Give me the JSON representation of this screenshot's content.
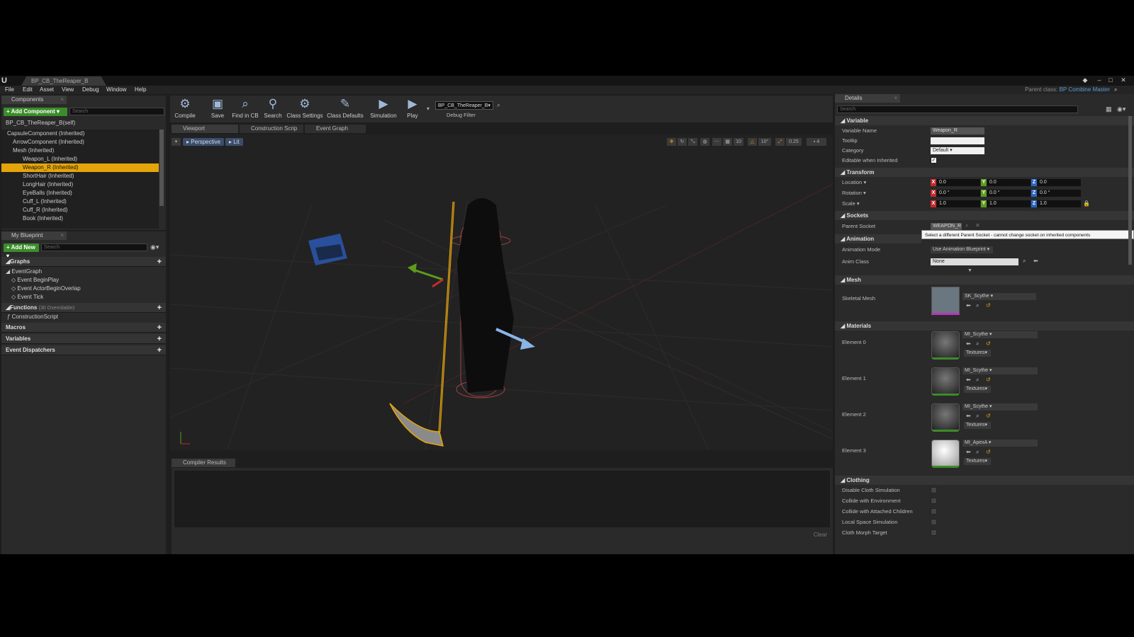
{
  "window": {
    "doc_tab": "BP_CB_TheReaper_B",
    "parent_class_label": "Parent class:",
    "parent_class": "BP Combine Master"
  },
  "menu": [
    "File",
    "Edit",
    "Asset",
    "View",
    "Debug",
    "Window",
    "Help"
  ],
  "components": {
    "tab": "Components",
    "add_button": "Add Component",
    "search_placeholder": "Search",
    "self": "BP_CB_TheReaper_B(self)",
    "tree": [
      "CapsuleComponent (Inherited)",
      "ArrowComponent (Inherited)",
      "Mesh (Inherited)",
      "Weapon_L (Inherited)",
      "Weapon_R (Inherited)",
      "ShortHair (Inherited)",
      "LongHair (Inherited)",
      "EyeBalls (Inherited)",
      "Cuff_L (Inherited)",
      "Cuff_R (Inherited)",
      "Book (Inherited)"
    ]
  },
  "my_blueprint": {
    "tab": "My Blueprint",
    "add_button": "Add New",
    "search_placeholder": "Search",
    "graphs": "Graphs",
    "event_graph": "EventGraph",
    "events": [
      "Event BeginPlay",
      "Event ActorBeginOverlap",
      "Event Tick"
    ],
    "functions": "Functions",
    "functions_note": "(30 Overridable)",
    "construction": "ConstructionScript",
    "macros": "Macros",
    "variables": "Variables",
    "dispatchers": "Event Dispatchers"
  },
  "toolbar": {
    "compile": "Compile",
    "save": "Save",
    "find": "Find in CB",
    "search": "Search",
    "class_settings": "Class Settings",
    "class_defaults": "Class Defaults",
    "simulation": "Simulation",
    "play": "Play",
    "debug_object": "BP_CB_TheReaper_B",
    "debug_filter": "Debug Filter"
  },
  "viewport": {
    "tabs": [
      "Viewport",
      "Construction Scrip",
      "Event Graph"
    ],
    "perspective": "Perspective",
    "lit": "Lit",
    "grid": "10",
    "angle": "10°",
    "scale": "0.25",
    "cam": "4"
  },
  "compiler": {
    "tab": "Compiler Results",
    "clear": "Clear"
  },
  "details": {
    "tab": "Details",
    "search_placeholder": "Search",
    "variable": {
      "title": "Variable",
      "name_label": "Variable Name",
      "name": "Weapon_R",
      "tooltip_label": "Tooltip",
      "category_label": "Category",
      "category": "Default",
      "editable_label": "Editable when Inherited"
    },
    "transform": {
      "title": "Transform",
      "location": "Location",
      "rotation": "Rotation",
      "scale": "Scale",
      "loc": [
        "0.0",
        "0.0",
        "0.0"
      ],
      "rot": [
        "0.0 °",
        "0.0 °",
        "0.0 °"
      ],
      "scl": [
        "1.0",
        "1.0",
        "1.0"
      ]
    },
    "sockets": {
      "title": "Sockets",
      "parent_label": "Parent Socket",
      "parent": "WEAPON_R",
      "tooltip": "Select a different Parent Socket - cannot change socket on inherited components"
    },
    "animation": {
      "title": "Animation",
      "mode_label": "Animation Mode",
      "mode": "Use Animation Blueprint",
      "class_label": "Anim Class",
      "class": "None"
    },
    "mesh": {
      "title": "Mesh",
      "label": "Skeletal Mesh",
      "value": "SK_Scythe"
    },
    "materials": {
      "title": "Materials",
      "textures": "Textures",
      "elements": [
        {
          "label": "Element 0",
          "value": "MI_Scythe"
        },
        {
          "label": "Element 1",
          "value": "MI_Scythe"
        },
        {
          "label": "Element 2",
          "value": "MI_Scythe"
        },
        {
          "label": "Element 3",
          "value": "MI_ApexA"
        }
      ]
    },
    "clothing": {
      "title": "Clothing",
      "items": [
        "Disable Cloth Simulation",
        "Collide with Environment",
        "Collide with Attached Children",
        "Local Space Simulation",
        "Cloth Morph Target"
      ]
    }
  },
  "colors": {
    "accent": "#e5a50a",
    "add_green": "#3b8c2a",
    "link_blue": "#5b9bd5"
  }
}
